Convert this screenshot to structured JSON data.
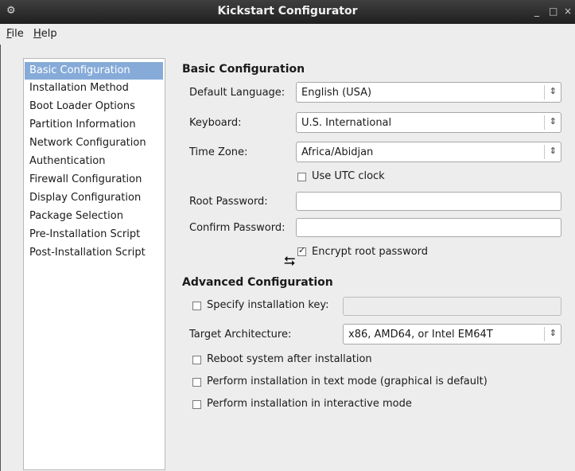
{
  "window": {
    "title": "Kickstart Configurator",
    "app_icon": "app-icon",
    "minimize": "_",
    "maximize": "□",
    "close": "×"
  },
  "menubar": [
    {
      "label": "File",
      "mnemonic": "F",
      "rest": "ile"
    },
    {
      "label": "Help",
      "mnemonic": "H",
      "rest": "elp"
    }
  ],
  "sidebar": {
    "selected": "Basic Configuration",
    "items": [
      "Basic Configuration",
      "Installation Method",
      "Boot Loader Options",
      "Partition Information",
      "Network Configuration",
      "Authentication",
      "Firewall Configuration",
      "Display Configuration",
      "Package Selection",
      "Pre-Installation Script",
      "Post-Installation Script"
    ]
  },
  "basic": {
    "heading": "Basic Configuration",
    "language_label": "Default Language:",
    "language_value": "English (USA)",
    "keyboard_label": "Keyboard:",
    "keyboard_value": "U.S. International",
    "timezone_label": "Time Zone:",
    "timezone_value": "Africa/Abidjan",
    "utc_label": "Use UTC clock",
    "utc_checked": false,
    "root_password_label": "Root Password:",
    "root_password_value": "",
    "confirm_password_label": "Confirm Password:",
    "confirm_password_value": "",
    "encrypt_label": "Encrypt root password",
    "encrypt_checked": true
  },
  "advanced": {
    "heading": "Advanced Configuration",
    "install_key_label": "Specify installation key:",
    "install_key_checked": false,
    "install_key_value": "",
    "arch_label": "Target Architecture:",
    "arch_value": "x86, AMD64, or Intel EM64T",
    "reboot_label": "Reboot system after installation",
    "reboot_checked": false,
    "textmode_label": "Perform installation in text mode (graphical is default)",
    "textmode_checked": false,
    "interactive_label": "Perform installation in interactive mode",
    "interactive_checked": false
  },
  "combo_arrow": "updown-arrow-icon",
  "colors": {
    "selection": "#86abd9",
    "titlebar": "#2a2a2a"
  }
}
